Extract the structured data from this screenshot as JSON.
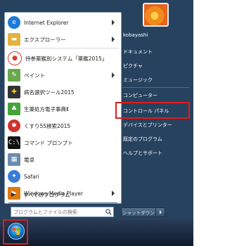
{
  "start_menu": {
    "programs": [
      {
        "label": "Internet Explorer",
        "icon": "internet-explorer-icon",
        "color": "#1c7ad9",
        "has_submenu": true
      },
      {
        "label": "エクスプローラー",
        "icon": "folder-icon",
        "color": "#e3b23c",
        "has_submenu": true
      },
      {
        "label": "持参薬鑑別システム「薬鑑2015」",
        "icon": "pill-icon",
        "color": "#d93a2b",
        "has_submenu": false
      },
      {
        "label": "ペイント",
        "icon": "paint-icon",
        "color": "#6aa84f",
        "has_submenu": true
      },
      {
        "label": "病名選択ツール2015",
        "icon": "tool-icon",
        "color": "#333333",
        "has_submenu": false
      },
      {
        "label": "生薬処方電子事典Ⅱ",
        "icon": "herb-icon",
        "color": "#45a33a",
        "has_submenu": false
      },
      {
        "label": "くすり55検索2015",
        "icon": "medicine-icon",
        "color": "#d0312d",
        "has_submenu": false
      },
      {
        "label": "コマンド プロンプト",
        "icon": "command-prompt-icon",
        "color": "#111111",
        "has_submenu": false
      },
      {
        "label": "電卓",
        "icon": "calculator-icon",
        "color": "#6c8bb0",
        "has_submenu": false
      },
      {
        "label": "Safari",
        "icon": "safari-icon",
        "color": "#3a7bd5",
        "has_submenu": false
      },
      {
        "label": "Windows Media Player",
        "icon": "media-player-icon",
        "color": "#e07a10",
        "has_submenu": true
      }
    ],
    "all_programs_label": "すべてのプログラム",
    "search_placeholder": "プログラムとファイルの検索",
    "user_name": "kobayashi",
    "right_items": [
      {
        "label": "ドキュメント"
      },
      {
        "label": "ピクチャ"
      },
      {
        "label": "ミュージック"
      },
      {
        "label": "コンピューター"
      },
      {
        "label": "コントロール パネル"
      },
      {
        "label": "デバイスとプリンター"
      },
      {
        "label": "既定のプログラム"
      },
      {
        "label": "ヘルプとサポート"
      }
    ],
    "shutdown_label": "シャットダウン",
    "highlight_color": "#e11b1b"
  }
}
